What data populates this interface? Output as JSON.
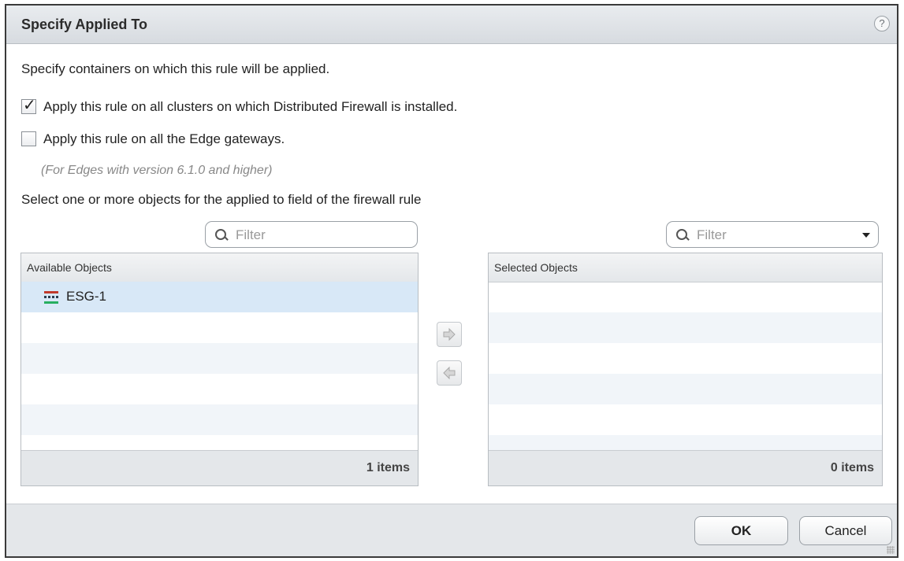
{
  "dialog": {
    "title": "Specify Applied To",
    "help_label": "?"
  },
  "content": {
    "intro": "Specify containers on which this rule will be applied.",
    "checkbox_dfw": {
      "label": "Apply this rule on all clusters on which Distributed Firewall is installed.",
      "checked": true
    },
    "checkbox_edge": {
      "label": "Apply this rule on all the Edge gateways.",
      "checked": false
    },
    "edge_note": "(For Edges with version 6.1.0 and higher)",
    "select_prompt": "Select one or more objects for the applied to field of the firewall rule"
  },
  "available": {
    "filter_placeholder": "Filter",
    "header": "Available Objects",
    "items": [
      {
        "label": "ESG-1",
        "icon": "edge-gateway-icon"
      }
    ],
    "count": "1 items"
  },
  "selected": {
    "filter_placeholder": "Filter",
    "header": "Selected Objects",
    "items": [],
    "count": "0 items"
  },
  "buttons": {
    "ok": "OK",
    "cancel": "Cancel"
  },
  "colors": {
    "selected_row": "#d8e8f7",
    "alt_row": "#f1f5f9",
    "footer_bg": "#e4e7ea"
  }
}
